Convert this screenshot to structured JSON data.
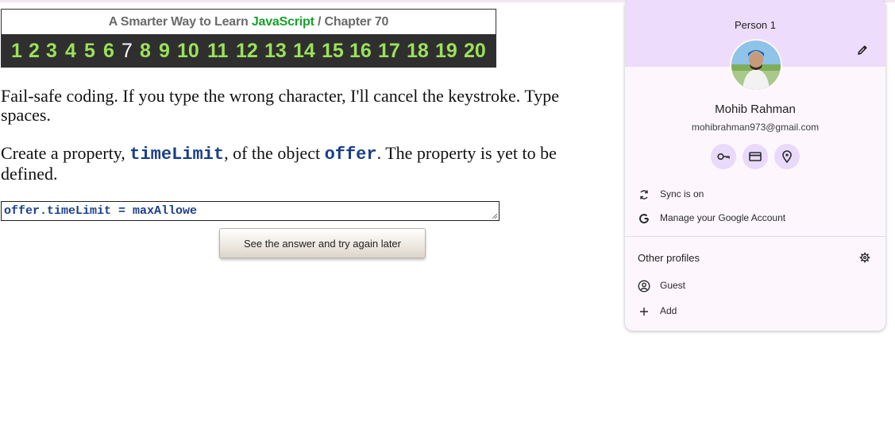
{
  "header": {
    "title_prefix": "A Smarter Way to Learn",
    "title_brand": "JavaScript",
    "title_sep": "/",
    "title_chapter": "Chapter 70",
    "chapters": [
      "1",
      "2",
      "3",
      "4",
      "5",
      "6",
      "7",
      "8",
      "9",
      "10",
      "11",
      "12",
      "13",
      "14",
      "15",
      "16",
      "17",
      "18",
      "19",
      "20"
    ],
    "current_chapter": "7"
  },
  "lesson": {
    "p1": "Fail-safe coding. If you type the wrong character, I'll cancel the keystroke. Type spaces.",
    "p2_a": "Create a property, ",
    "p2_code1": "timeLimit",
    "p2_b": ", of the object ",
    "p2_code2": "offer",
    "p2_c": ". The property is yet to be defined.",
    "answer_value": "offer.timeLimit = maxAllowe",
    "see_answer_label": "See the answer and try again later"
  },
  "profile": {
    "person_label": "Person 1",
    "full_name": "Mohib Rahman",
    "email": "mohibrahman973@gmail.com",
    "sync_label": "Sync is on",
    "manage_label": "Manage your Google Account",
    "other_profiles_label": "Other profiles",
    "guest_label": "Guest",
    "add_label": "Add",
    "icons": {
      "edit": "pencil-icon",
      "passwords": "key-icon",
      "payments": "card-icon",
      "addresses": "location-pin-icon",
      "sync": "sync-icon",
      "google": "google-g-icon",
      "settings": "gear-icon",
      "guest": "guest-icon",
      "add": "plus-icon"
    }
  },
  "colors": {
    "brand_green": "#17a02a",
    "chapter_green": "#9be15a",
    "code_blue": "#1a3f8c",
    "card_header": "#eddcfb"
  }
}
